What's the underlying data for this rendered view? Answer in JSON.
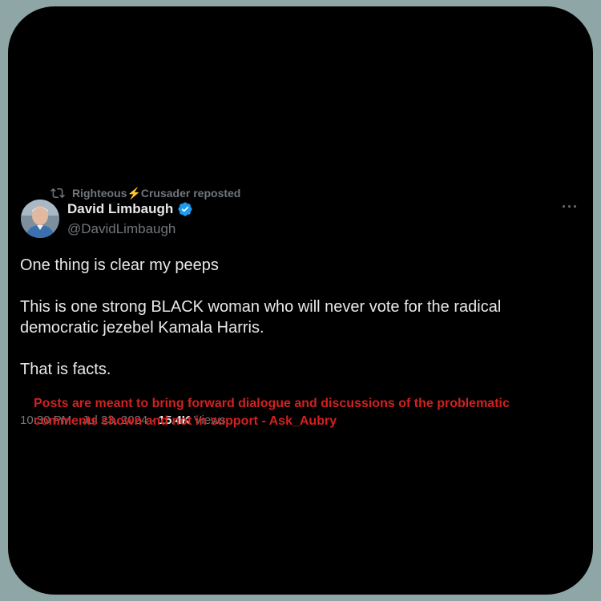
{
  "repost": {
    "label": "Righteous⚡Crusader reposted",
    "icon": "repost-icon"
  },
  "author": {
    "display_name": "David Limbaugh",
    "handle": "@DavidLimbaugh",
    "verified": true,
    "verified_color": "#1d9bf0"
  },
  "more_label": "···",
  "tweet": {
    "paragraphs": [
      "One thing is clear my peeps",
      "This is one strong BLACK woman who will never vote for the radical democratic jezebel Kamala Harris.",
      "That is facts."
    ]
  },
  "meta": {
    "time_date": "10:30 PM · Jul 23, 2024",
    "separator": " · ",
    "views_count": "15.4K",
    "views_label": " Views"
  },
  "disclaimer": "Posts are meant to bring forward dialogue and discussions of the problematic comments shown and not in support - Ask_Aubry",
  "colors": {
    "background": "#8fa6a6",
    "card": "#000000",
    "text": "#e7e9ea",
    "muted": "#71767b",
    "disclaimer": "#d42020"
  }
}
